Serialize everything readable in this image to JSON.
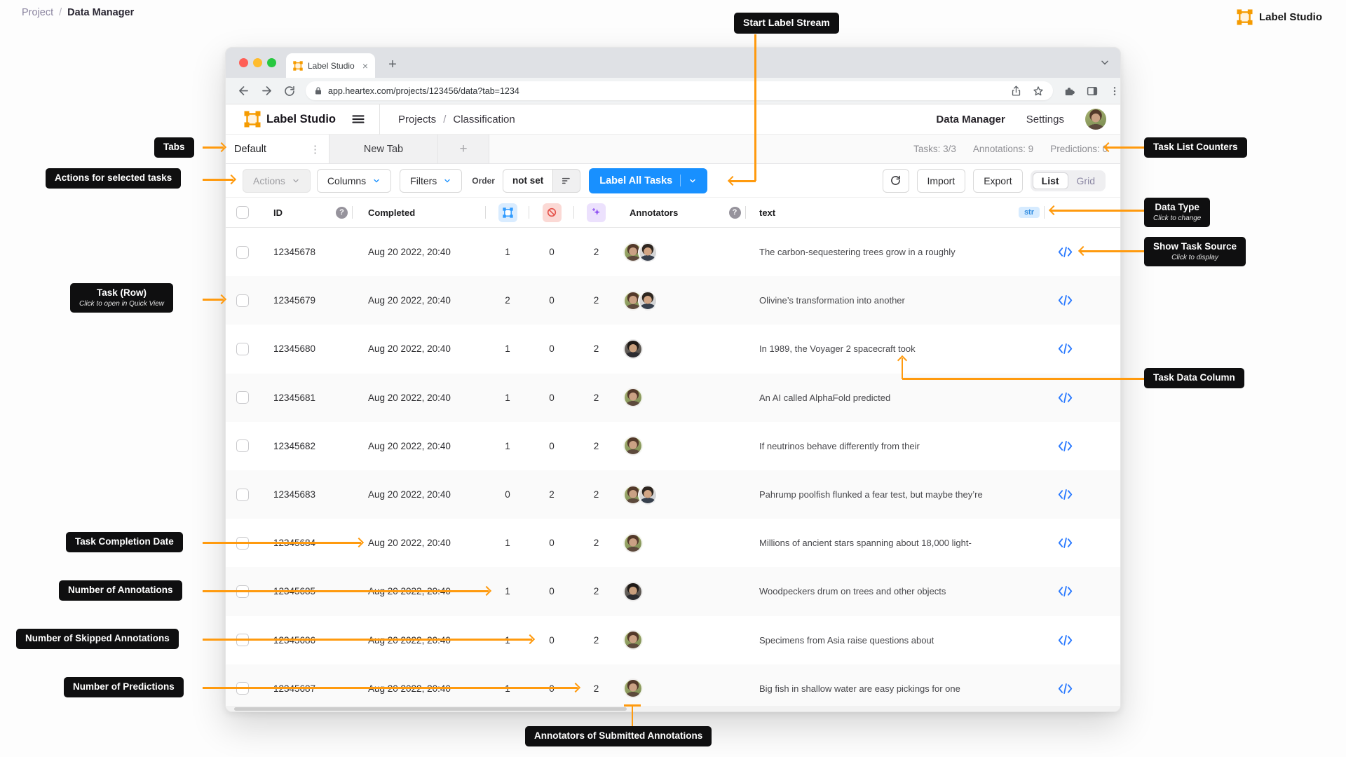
{
  "page": {
    "breadcrumb": {
      "parent": "Project",
      "separator": "/",
      "current": "Data Manager"
    },
    "brand": "Label Studio"
  },
  "callouts": {
    "start_label_stream": "Start Label Stream",
    "tabs": "Tabs",
    "actions_selected": "Actions for selected tasks",
    "task_row_title": "Task (Row)",
    "task_row_sub": "Click to open in Quick View",
    "completion_date": "Task Completion Date",
    "num_annotations": "Number of Annotations",
    "num_skipped": "Number of Skipped Annotations",
    "num_predictions": "Number of Predictions",
    "task_list_counters": "Task List Counters",
    "data_type_title": "Data Type",
    "data_type_sub": "Click to change",
    "show_source_title": "Show Task Source",
    "show_source_sub": "Click to display",
    "task_data_column": "Task Data Column",
    "annotators_submitted": "Annotators of Submitted Annotations"
  },
  "browser": {
    "tab_title": "Label Studio",
    "close_glyph": "×",
    "new_tab_glyph": "+",
    "url": "app.heartex.com/projects/123456/data?tab=1234"
  },
  "header": {
    "brand": "Label Studio",
    "breadcrumb_parent": "Projects",
    "breadcrumb_sep": "/",
    "breadcrumb_current": "Classification",
    "nav_data_manager": "Data Manager",
    "nav_settings": "Settings"
  },
  "tabs": {
    "active": "Default",
    "kebab_glyph": "⋮",
    "inactive": "New Tab",
    "add_glyph": "+"
  },
  "counters": {
    "tasks": "Tasks: 3/3",
    "annotations": "Annotations: 9",
    "predictions": "Predictions: 0"
  },
  "toolbar": {
    "actions": "Actions",
    "columns": "Columns",
    "filters": "Filters",
    "order_label": "Order",
    "order_value": "not set",
    "label_all_tasks": "Label All Tasks",
    "import": "Import",
    "export": "Export",
    "view_list": "List",
    "view_grid": "Grid"
  },
  "table": {
    "header": {
      "id": "ID",
      "completed": "Completed",
      "annotators": "Annotators",
      "text": "text",
      "type_badge": "str",
      "help_glyph": "?"
    },
    "rows": [
      {
        "id": "12345678",
        "completed": "Aug 20 2022, 20:40",
        "annotations": "1",
        "skipped": "0",
        "predictions": "2",
        "annotators": [
          "woman-green",
          "man-light"
        ],
        "text": "The carbon-sequestering trees grow in a roughly"
      },
      {
        "id": "12345679",
        "completed": "Aug 20 2022, 20:40",
        "annotations": "2",
        "skipped": "0",
        "predictions": "2",
        "annotators": [
          "woman-green",
          "man-light"
        ],
        "text": "Olivine’s transformation into another"
      },
      {
        "id": "12345680",
        "completed": "Aug 20 2022, 20:40",
        "annotations": "1",
        "skipped": "0",
        "predictions": "2",
        "annotators": [
          "man-dark"
        ],
        "text": "In 1989, the Voyager 2 spacecraft took"
      },
      {
        "id": "12345681",
        "completed": "Aug 20 2022, 20:40",
        "annotations": "1",
        "skipped": "0",
        "predictions": "2",
        "annotators": [
          "woman-green"
        ],
        "text": "An AI called AlphaFold predicted"
      },
      {
        "id": "12345682",
        "completed": "Aug 20 2022, 20:40",
        "annotations": "1",
        "skipped": "0",
        "predictions": "2",
        "annotators": [
          "woman-green"
        ],
        "text": "If neutrinos behave differently from their"
      },
      {
        "id": "12345683",
        "completed": "Aug 20 2022, 20:40",
        "annotations": "0",
        "skipped": "2",
        "predictions": "2",
        "annotators": [
          "woman-green",
          "man-light"
        ],
        "text": "Pahrump poolfish flunked a fear test, but maybe they’re"
      },
      {
        "id": "12345684",
        "completed": "Aug 20 2022, 20:40",
        "annotations": "1",
        "skipped": "0",
        "predictions": "2",
        "annotators": [
          "woman-green"
        ],
        "text": "Millions of ancient stars spanning about 18,000 light-"
      },
      {
        "id": "12345685",
        "completed": "Aug 20 2022, 20:40",
        "annotations": "1",
        "skipped": "0",
        "predictions": "2",
        "annotators": [
          "man-dark"
        ],
        "text": "Woodpeckers drum on trees and other objects"
      },
      {
        "id": "12345686",
        "completed": "Aug 20 2022, 20:40",
        "annotations": "1",
        "skipped": "0",
        "predictions": "2",
        "annotators": [
          "woman-green"
        ],
        "text": "Specimens from Asia raise questions about"
      },
      {
        "id": "12345687",
        "completed": "Aug 20 2022, 20:40",
        "annotations": "1",
        "skipped": "0",
        "predictions": "2",
        "annotators": [
          "woman-green"
        ],
        "text": "Big fish in shallow water are easy pickings for one"
      }
    ]
  },
  "colors": {
    "arrow_orange": "#FF9A0E",
    "brand_orange": "#F59B00",
    "primary_blue": "#1890FF",
    "badge_blue_text": "#2F8BE0",
    "badge_blue_bg": "#D6EBFF",
    "icon_red": "#E5534B",
    "icon_purple": "#9053F3",
    "window_controls": [
      "#FF5F57",
      "#FEBC2E",
      "#28C840"
    ]
  }
}
